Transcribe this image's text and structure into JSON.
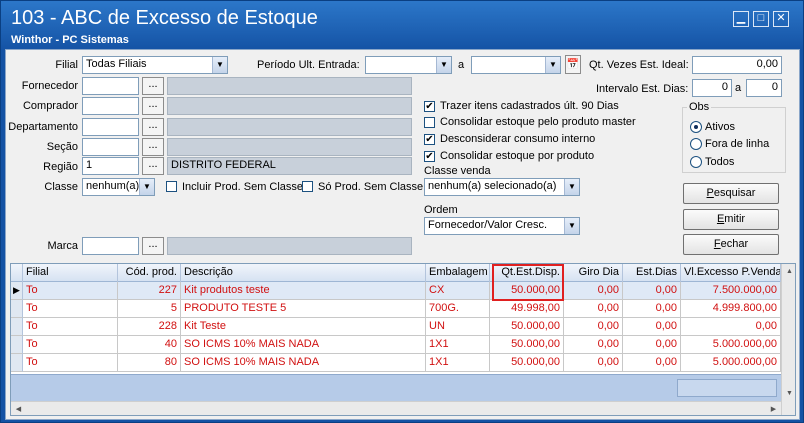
{
  "window": {
    "title": "103 - ABC de Excesso de Estoque",
    "subtitle": "Winthor - PC Sistemas",
    "buttons": {
      "minimize": "▁",
      "maximize": "□",
      "close": "✕"
    }
  },
  "filters": {
    "filial_label": "Filial",
    "filial_value": "Todas Filiais",
    "periodo_label": "Período Ult. Entrada:",
    "periodo_from": "",
    "periodo_sep": "a",
    "periodo_to": "",
    "qt_vezes_label": "Qt. Vezes Est. Ideal:",
    "qt_vezes_value": "0,00",
    "intervalo_label": "Intervalo Est. Dias:",
    "intervalo_from": "0",
    "intervalo_sep": "a",
    "intervalo_to": "0",
    "fornecedor_label": "Fornecedor",
    "fornecedor_code": "",
    "fornecedor_name": "",
    "comprador_label": "Comprador",
    "comprador_code": "",
    "comprador_name": "",
    "departamento_label": "Departamento",
    "departamento_code": "",
    "departamento_name": "",
    "secao_label": "Seção",
    "secao_code": "",
    "secao_name": "",
    "regiao_label": "Região",
    "regiao_code": "1",
    "regiao_name": "DISTRITO FEDERAL",
    "classe_label": "Classe",
    "classe_value": "nenhum(a)",
    "incluir_label": "Incluir Prod. Sem Classe",
    "so_label": "Só Prod. Sem Classe",
    "marca_label": "Marca",
    "marca_code": "",
    "marca_name": "",
    "dots": "..."
  },
  "options": {
    "trazer": {
      "label": "Trazer itens cadastrados últ. 90 Dias",
      "checked": "✔"
    },
    "consolidar_master": {
      "label": "Consolidar estoque pelo produto master",
      "checked": ""
    },
    "desconsiderar": {
      "label": "Desconsiderar consumo interno",
      "checked": "✔"
    },
    "consolidar_produto": {
      "label": "Consolidar estoque por produto",
      "checked": "✔"
    },
    "classe_venda_label": "Classe venda",
    "classe_venda_value": "nenhum(a) selecionado(a)",
    "ordem_label": "Ordem",
    "ordem_value": "Fornecedor/Valor Cresc."
  },
  "obs": {
    "title": "Obs",
    "ativos": "Ativos",
    "fora": "Fora de linha",
    "todos": "Todos",
    "selected": "Ativos"
  },
  "actions": {
    "pesquisar_first": "P",
    "pesquisar_rest": "esquisar",
    "emitir_first": "E",
    "emitir_rest": "mitir",
    "fechar_first": "F",
    "fechar_rest": "echar"
  },
  "grid": {
    "columns": [
      "Filial",
      "Cód. prod.",
      "Descrição",
      "Embalagem",
      "Qt.Est.Disp.",
      "Giro Dia",
      "Est.Dias",
      "Vl.Excesso P.Venda"
    ],
    "rows": [
      [
        "To",
        "227",
        "Kit produtos teste",
        "CX",
        "50.000,00",
        "0,00",
        "0,00",
        "7.500.000,00"
      ],
      [
        "To",
        "5",
        "PRODUTO TESTE 5",
        "700G.",
        "49.998,00",
        "0,00",
        "0,00",
        "4.999.800,00"
      ],
      [
        "To",
        "228",
        "Kit Teste",
        "UN",
        "50.000,00",
        "0,00",
        "0,00",
        "0,00"
      ],
      [
        "To",
        "40",
        "SO ICMS 10% MAIS NADA",
        "1X1",
        "50.000,00",
        "0,00",
        "0,00",
        "5.000.000,00"
      ],
      [
        "To",
        "80",
        "SO ICMS 10% MAIS NADA",
        "1X1",
        "50.000,00",
        "0,00",
        "0,00",
        "5.000.000,00"
      ]
    ],
    "highlight_color": "#e02020"
  }
}
